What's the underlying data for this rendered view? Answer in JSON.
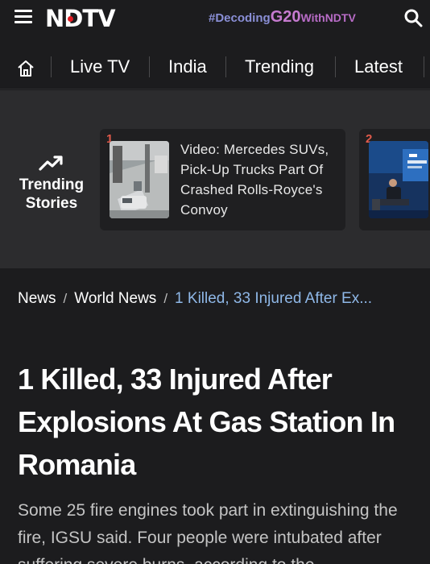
{
  "header": {
    "logo": "NDTV",
    "campaign": {
      "part1": "#Decoding",
      "part2": "G20",
      "part3": "WithNDTV"
    }
  },
  "nav": {
    "items": [
      "Live TV",
      "India",
      "Trending",
      "Latest"
    ]
  },
  "trending": {
    "label_line1": "Trending",
    "label_line2": "Stories",
    "cards": [
      {
        "rank": "1",
        "title": "Video: Mercedes SUVs, Pick-Up Trucks Part Of Crashed Rolls-Royce's Convoy"
      },
      {
        "rank": "2",
        "title": ""
      }
    ]
  },
  "breadcrumb": {
    "items": [
      "News",
      "World News"
    ],
    "separator": "/",
    "current": "1 Killed, 33 Injured After Ex..."
  },
  "article": {
    "headline": "1 Killed, 33 Injured After Explosions At Gas Station In Romania",
    "summary": "Some 25 fire engines took part in extinguishing the fire, IGSU said. Four people were intubated after suffering severe burns, according to the"
  },
  "colors": {
    "background": "#1c1c1e",
    "trending_band": "#2c2c2e",
    "rank_red": "#e05a4a",
    "breadcrumb_current": "#8fb8e8"
  }
}
